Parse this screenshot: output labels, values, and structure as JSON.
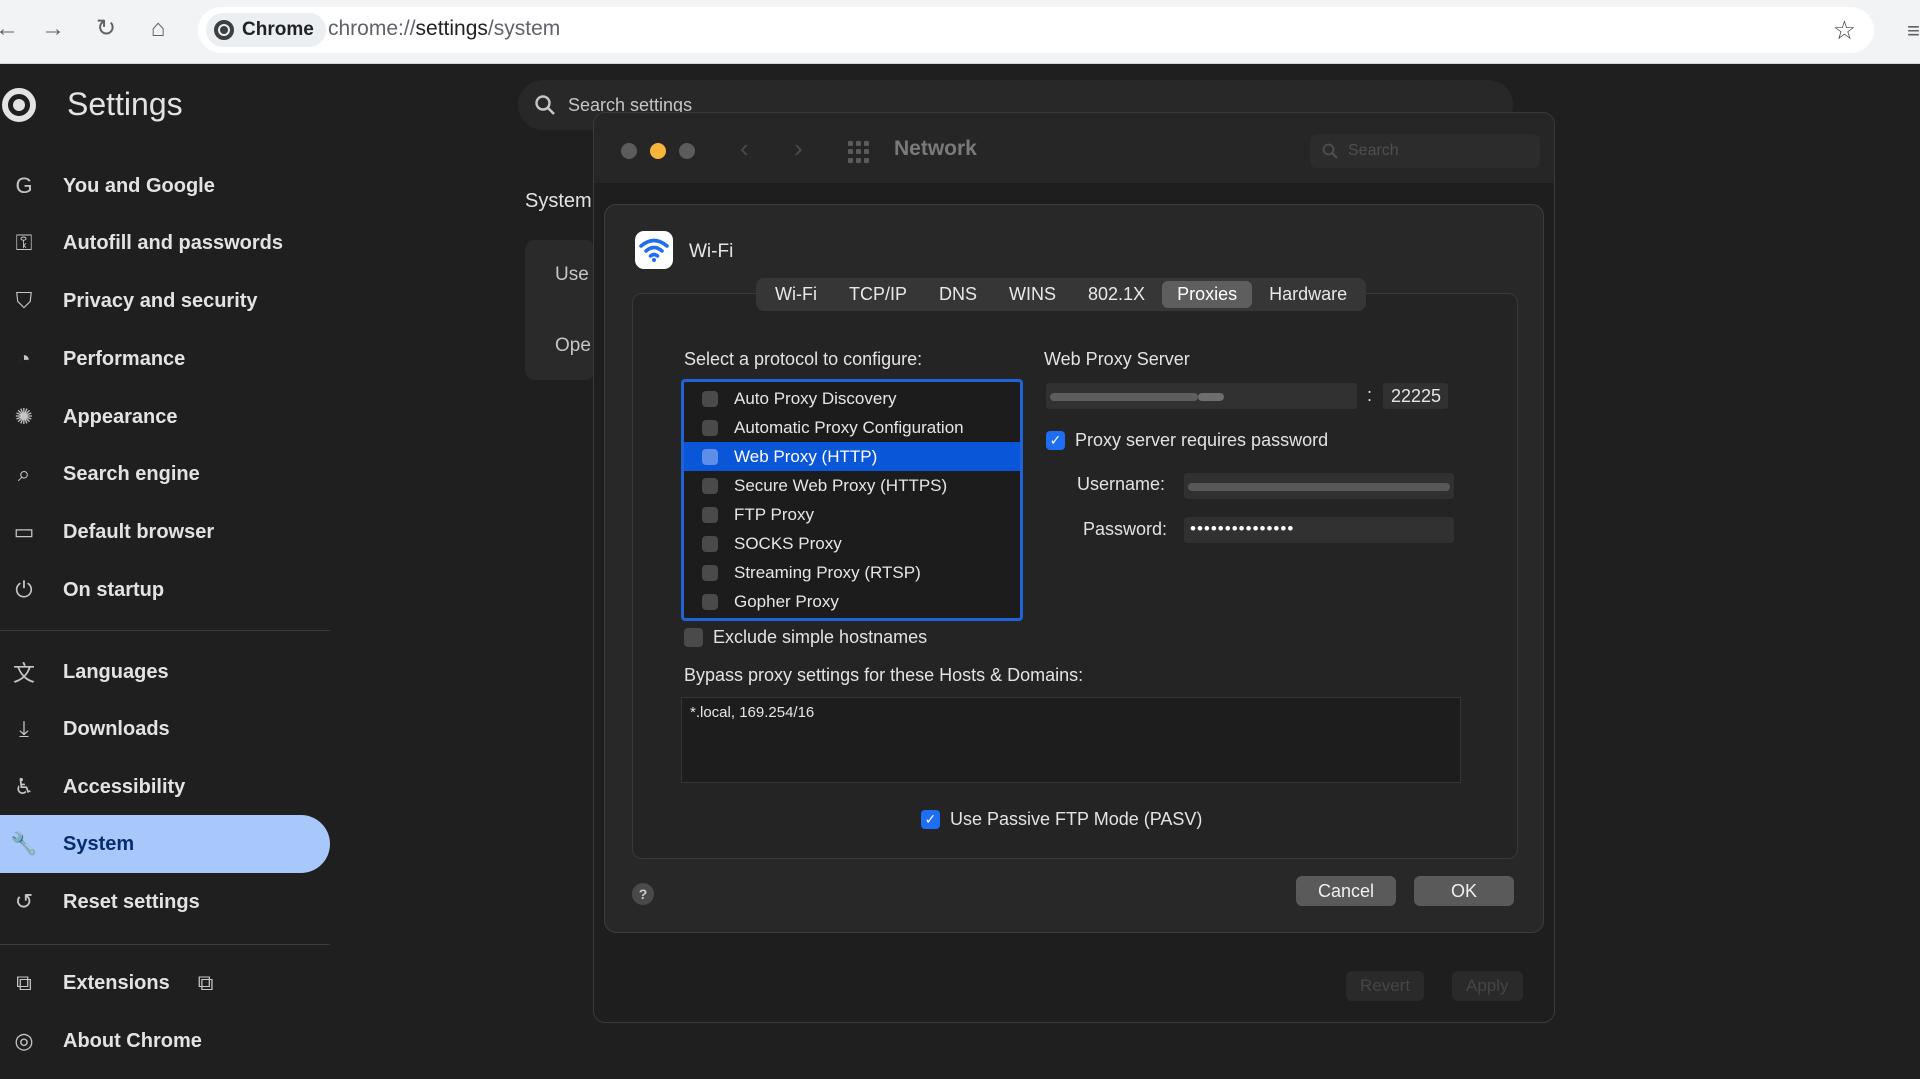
{
  "browser": {
    "chip_label": "Chrome",
    "url_prefix": "chrome://",
    "url_path": "settings",
    "url_suffix": "/system"
  },
  "settings": {
    "title": "Settings",
    "search_placeholder": "Search settings",
    "section_title": "System",
    "card_rows": [
      "Use",
      "Ope"
    ],
    "nav": [
      {
        "label": "You and Google",
        "icon": "google-icon"
      },
      {
        "label": "Autofill and passwords",
        "icon": "key-icon"
      },
      {
        "label": "Privacy and security",
        "icon": "shield-icon"
      },
      {
        "label": "Performance",
        "icon": "speedometer-icon"
      },
      {
        "label": "Appearance",
        "icon": "palette-icon"
      },
      {
        "label": "Search engine",
        "icon": "search-icon"
      },
      {
        "label": "Default browser",
        "icon": "browser-window-icon"
      },
      {
        "label": "On startup",
        "icon": "power-icon"
      },
      {
        "label": "Languages",
        "icon": "translate-icon"
      },
      {
        "label": "Downloads",
        "icon": "download-icon"
      },
      {
        "label": "Accessibility",
        "icon": "accessibility-icon"
      },
      {
        "label": "System",
        "icon": "wrench-icon",
        "active": true
      },
      {
        "label": "Reset settings",
        "icon": "reset-icon"
      },
      {
        "label": "Extensions",
        "icon": "puzzle-icon"
      },
      {
        "label": "About Chrome",
        "icon": "chrome-icon"
      }
    ]
  },
  "network": {
    "window_title": "Network",
    "search_placeholder": "Search",
    "revert_label": "Revert",
    "apply_label": "Apply",
    "interface_name": "Wi-Fi",
    "tabs": [
      "Wi-Fi",
      "TCP/IP",
      "DNS",
      "WINS",
      "802.1X",
      "Proxies",
      "Hardware"
    ],
    "active_tab": "Proxies",
    "select_protocol_label": "Select a protocol to configure:",
    "protocols": [
      "Auto Proxy Discovery",
      "Automatic Proxy Configuration",
      "Web Proxy (HTTP)",
      "Secure Web Proxy (HTTPS)",
      "FTP Proxy",
      "SOCKS Proxy",
      "Streaming Proxy (RTSP)",
      "Gopher Proxy"
    ],
    "selected_protocol": "Web Proxy (HTTP)",
    "web_proxy_server_label": "Web Proxy Server",
    "port_separator": ":",
    "port": "22225",
    "requires_password_label": "Proxy server requires password",
    "requires_password_checked": true,
    "username_label": "Username:",
    "password_label": "Password:",
    "password_mask": "•••••••••••••••",
    "exclude_simple_hostnames_label": "Exclude simple hostnames",
    "bypass_label": "Bypass proxy settings for these Hosts & Domains:",
    "bypass_value": "*.local, 169.254/16",
    "passive_ftp_label": "Use Passive FTP Mode (PASV)",
    "passive_ftp_checked": true,
    "help_label": "?",
    "cancel_label": "Cancel",
    "ok_label": "OK"
  },
  "colors": {
    "accent_blue": "#1f63d6",
    "active_nav": "#a8c7fa",
    "traffic_close": "#5c5c5c",
    "traffic_minimize": "#f6b63a",
    "traffic_zoom": "#5c5c5c"
  }
}
